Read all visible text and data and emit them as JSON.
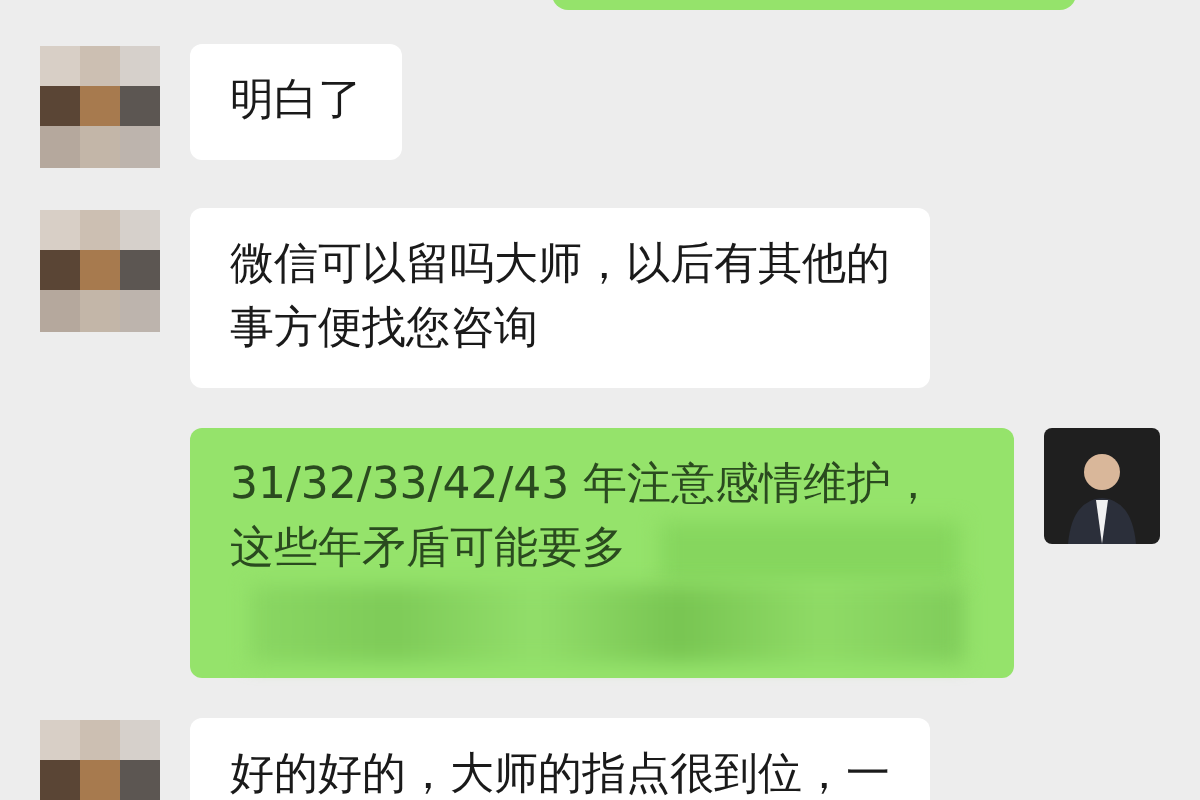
{
  "messages": [
    {
      "kind": "partial"
    },
    {
      "kind": "incoming",
      "lines": [
        "明白了"
      ]
    },
    {
      "kind": "incoming",
      "lines": [
        "微信可以留吗大师，以后有其他的",
        "事方便找您咨询"
      ]
    },
    {
      "kind": "outgoing",
      "lines": [
        "31/32/33/42/43 年注意感情维护，",
        "这些年矛盾可能要多"
      ],
      "redacted": true
    },
    {
      "kind": "incoming",
      "lines": [
        "好的好的，大师的指点很到位，一"
      ]
    }
  ]
}
